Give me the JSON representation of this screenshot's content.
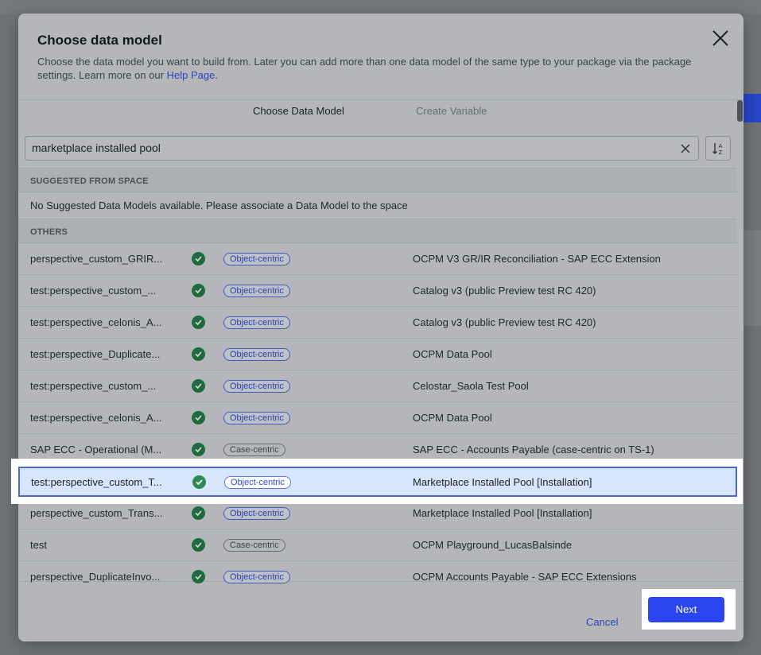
{
  "dialog": {
    "title": "Choose data model",
    "description": "Choose the data model you want to build from. Later you can add more than one data model of the same type to your package via the package settings. Learn more on our ",
    "help_link": "Help Page",
    "help_suffix": "."
  },
  "tabs": [
    {
      "label": "Choose Data Model",
      "active": true
    },
    {
      "label": "Create Variable",
      "active": false
    }
  ],
  "search": {
    "value": "marketplace installed pool"
  },
  "sections": {
    "suggested": "SUGGESTED FROM SPACE",
    "no_suggested": "No Suggested Data Models available. Please associate a Data Model to the space",
    "others": "OTHERS"
  },
  "rows": [
    {
      "name": "perspective_custom_GRIR...",
      "badge": "Object-centric",
      "type": "obj",
      "pool": "OCPM V3 GR/IR Reconciliation - SAP ECC Extension"
    },
    {
      "name": "test:perspective_custom_...",
      "badge": "Object-centric",
      "type": "obj",
      "pool": "Catalog v3 (public Preview test RC 420)"
    },
    {
      "name": "test:perspective_celonis_A...",
      "badge": "Object-centric",
      "type": "obj",
      "pool": "Catalog v3 (public Preview test RC 420)"
    },
    {
      "name": "test:perspective_Duplicate...",
      "badge": "Object-centric",
      "type": "obj",
      "pool": "OCPM Data Pool"
    },
    {
      "name": "test:perspective_custom_...",
      "badge": "Object-centric",
      "type": "obj",
      "pool": "Celostar_Saola Test Pool"
    },
    {
      "name": "test:perspective_celonis_A...",
      "badge": "Object-centric",
      "type": "obj",
      "pool": "OCPM Data Pool"
    },
    {
      "name": "SAP ECC - Operational (M...",
      "badge": "Case-centric",
      "type": "case",
      "pool": "SAP ECC - Accounts Payable (case-centric on TS-1)"
    }
  ],
  "selected_row": {
    "name": "test:perspective_custom_T...",
    "badge": "Object-centric",
    "pool": "Marketplace Installed Pool [Installation]"
  },
  "rows_after": [
    {
      "name": "perspective_custom_Trans...",
      "badge": "Object-centric",
      "type": "obj",
      "pool": "Marketplace Installed Pool [Installation]"
    },
    {
      "name": "test",
      "badge": "Case-centric",
      "type": "case",
      "pool": "OCPM Playground_LucasBalsinde"
    },
    {
      "name": "perspective_DuplicateInvo...",
      "badge": "Object-centric",
      "type": "obj",
      "pool": "OCPM Accounts Payable - SAP ECC Extensions"
    }
  ],
  "footer": {
    "cancel_label": "Cancel",
    "next_label": "Next"
  }
}
